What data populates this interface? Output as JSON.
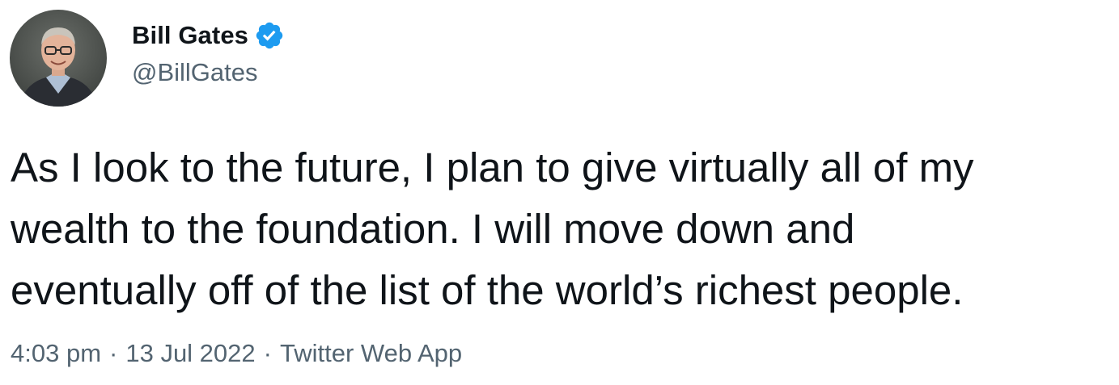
{
  "author": {
    "display_name": "Bill Gates",
    "handle": "@BillGates",
    "verified": true,
    "verified_icon": "verified-badge-icon"
  },
  "tweet": {
    "text": "As I look to the future, I plan to give virtually all of my\nwealth to the foundation. I will move down and\neventually off of the list of the world’s richest people."
  },
  "meta": {
    "time": "4:03 pm",
    "date": "13 Jul 2022",
    "source": "Twitter Web App",
    "separator": "·"
  },
  "colors": {
    "verified": "#1d9bf0",
    "secondary_text": "#536471",
    "primary_text": "#0f1419"
  }
}
